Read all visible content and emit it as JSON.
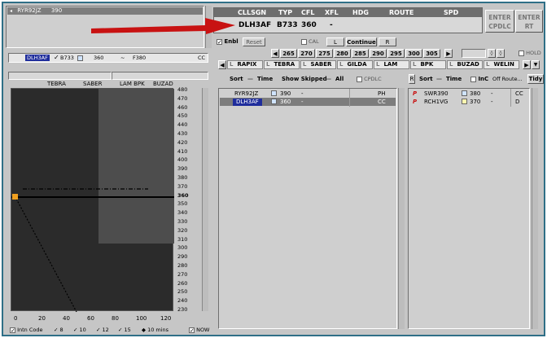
{
  "top_left": {
    "callsign": "RYR92JZ",
    "cfl": "390"
  },
  "flight_bar": {
    "callsign": "DLH3AF",
    "type": "B733",
    "cfl": "360",
    "sep": "~",
    "pel": "F380",
    "tag": "CC"
  },
  "header": {
    "col_cllsgn": "CLLSGN",
    "col_typ": "TYP",
    "col_cfl": "CFL",
    "col_xfl": "XFL",
    "col_hdg": "HDG",
    "col_route": "ROUTE",
    "col_spd": "SPD",
    "val_cllsgn": "DLH3AF",
    "val_typ": "B733",
    "val_cfl": "360",
    "val_xfl": "-",
    "enter_cpdlc": "ENTER CPDLC",
    "enter_rt": "ENTER RT"
  },
  "controls": {
    "enbl": "Enbl",
    "reset": "Reset",
    "cal": "CAL",
    "l": "L",
    "continue": "Continue",
    "r": "R",
    "hold": "HOLD",
    "fl_values": [
      "265",
      "270",
      "275",
      "280",
      "285",
      "290",
      "295",
      "300",
      "305"
    ]
  },
  "route_points": [
    "RAPIX",
    "TEBRA",
    "SABER",
    "GILDA",
    "LAM",
    "BPK",
    "BUZAD",
    "WELIN"
  ],
  "profile": {
    "waypoints": [
      "TEBRA",
      "SABER",
      "LAM BPK",
      "BUZAD"
    ],
    "y_ticks": [
      "480",
      "470",
      "460",
      "450",
      "440",
      "430",
      "420",
      "410",
      "400",
      "390",
      "380",
      "370",
      "360",
      "350",
      "340",
      "330",
      "320",
      "310",
      "300",
      "290",
      "280",
      "270",
      "260",
      "250",
      "240",
      "230"
    ],
    "x_ticks": [
      "0",
      "20",
      "40",
      "60",
      "80",
      "100",
      "120"
    ],
    "bottom": {
      "intn_code": "Intn Code",
      "v8": "8",
      "v10": "10",
      "v12": "12",
      "v15": "15",
      "mins": "10 mins",
      "now": "NOW"
    }
  },
  "list_left": {
    "sort": "Sort",
    "time": "Time",
    "show_skipped": "Show Skipped",
    "all": "All",
    "cpdlc": "CPDLC",
    "rows": [
      {
        "callsign": "RYR92JZ",
        "cfl": "390",
        "dash": "-",
        "tag": "PH",
        "selected": false
      },
      {
        "callsign": "DLH3AF",
        "cfl": "360",
        "dash": "-",
        "tag": "CC",
        "selected": true
      }
    ]
  },
  "list_right": {
    "sort": "Sort",
    "time": "Time",
    "inc": "InC",
    "off_route": "Off Route...",
    "tidy": "Tidy",
    "rows": [
      {
        "callsign": "SWR390",
        "cfl": "380",
        "dash": "-",
        "tag": "CC",
        "flag": "P"
      },
      {
        "callsign": "RCH1VG",
        "cfl": "370",
        "dash": "-",
        "tag": "D",
        "flag": "P"
      }
    ]
  },
  "colors": {
    "arrow": "#c81212",
    "selected_row": "#1f2d9c",
    "header_bar": "#6e6e6e",
    "plot_bg": "#2b2b2b",
    "plot_zone": "#4d4d4d",
    "aircraft_marker": "#f0a020"
  }
}
